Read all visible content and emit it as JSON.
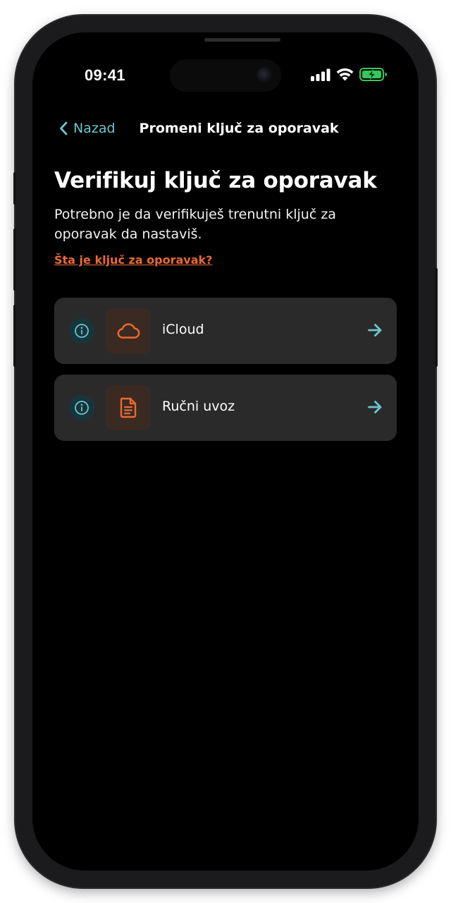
{
  "status_bar": {
    "time": "09:41"
  },
  "nav": {
    "back_label": "Nazad",
    "title": "Promeni ključ za oporavak"
  },
  "content": {
    "title": "Verifikuj ključ za oporavak",
    "subtitle": "Potrebno je da verifikuješ trenutni ključ za oporavak da nastaviš.",
    "help_link": "Šta je ključ za oporavak?"
  },
  "options": [
    {
      "label": "iCloud",
      "icon": "cloud-icon"
    },
    {
      "label": "Ručni uvoz",
      "icon": "document-icon"
    }
  ],
  "colors": {
    "accent_teal": "#6cc6cd",
    "accent_orange": "#ea6a34",
    "card_background": "#2a2a2b",
    "screen_background": "#000000",
    "battery_green": "#34c759"
  }
}
